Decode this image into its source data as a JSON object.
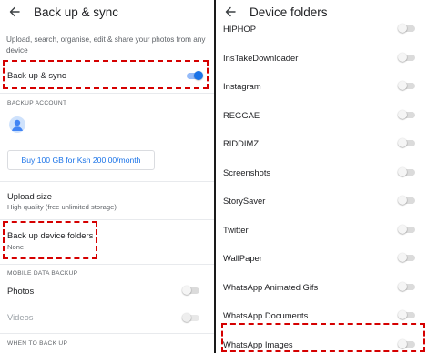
{
  "left": {
    "title": "Back up & sync",
    "description": "Upload, search, organise, edit & share your photos from any device",
    "backup_sync": {
      "label": "Back up & sync",
      "enabled": true
    },
    "backup_account_header": "BACKUP ACCOUNT",
    "buy_button": "Buy 100 GB for Ksh 200.00/month",
    "upload_size": {
      "label": "Upload size",
      "value": "High quality (free unlimited storage)"
    },
    "device_folders": {
      "label": "Back up device folders",
      "value": "None"
    },
    "mobile_data_header": "MOBILE DATA BACKUP",
    "photos": {
      "label": "Photos",
      "enabled": false
    },
    "videos": {
      "label": "Videos",
      "enabled": false
    },
    "when_header": "WHEN TO BACK UP"
  },
  "right": {
    "title": "Device folders",
    "folders": [
      {
        "name": "HIPHOP",
        "enabled": false
      },
      {
        "name": "InsTakeDownloader",
        "enabled": false
      },
      {
        "name": "Instagram",
        "enabled": false
      },
      {
        "name": "REGGAE",
        "enabled": false
      },
      {
        "name": "RIDDIMZ",
        "enabled": false
      },
      {
        "name": "Screenshots",
        "enabled": false
      },
      {
        "name": "StorySaver",
        "enabled": false
      },
      {
        "name": "Twitter",
        "enabled": false
      },
      {
        "name": "WallPaper",
        "enabled": false
      },
      {
        "name": "WhatsApp Animated Gifs",
        "enabled": false
      },
      {
        "name": "WhatsApp Documents",
        "enabled": false
      },
      {
        "name": "WhatsApp Images",
        "enabled": false
      }
    ]
  },
  "colors": {
    "accent": "#1a73e8",
    "highlight": "#d50000",
    "divider": "#1a1a1a"
  }
}
